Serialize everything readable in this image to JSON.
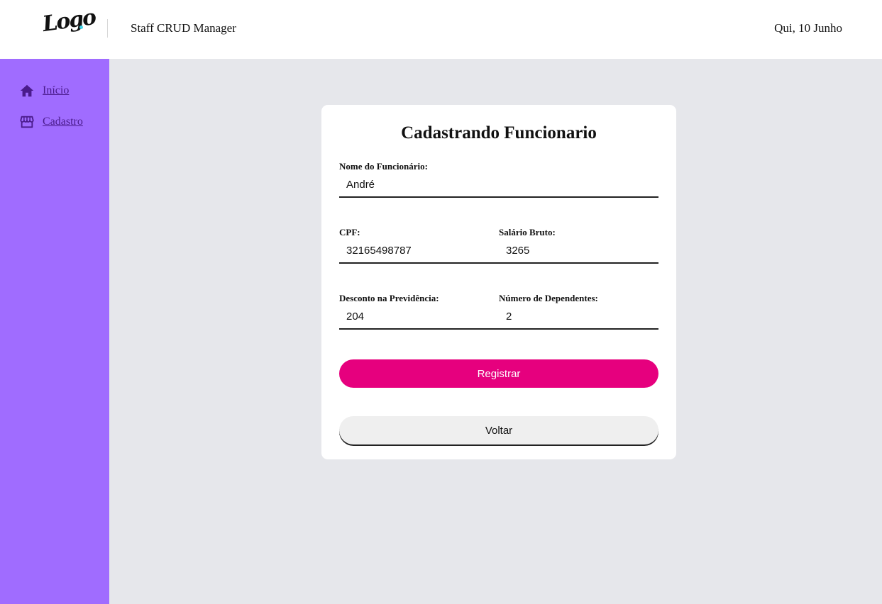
{
  "header": {
    "logo_text": "Logo",
    "app_title": "Staff CRUD Manager",
    "date": "Qui, 10 Junho"
  },
  "sidebar": {
    "items": [
      {
        "label": "Início",
        "icon": "home-icon"
      },
      {
        "label": "Cadastro",
        "icon": "store-icon"
      }
    ]
  },
  "form": {
    "title": "Cadastrando Funcionario",
    "fields": {
      "nome": {
        "label": "Nome do Funcionário:",
        "value": "André"
      },
      "cpf": {
        "label": "CPF:",
        "value": "32165498787"
      },
      "salario": {
        "label": "Salário Bruto:",
        "value": "3265"
      },
      "desconto": {
        "label": "Desconto na Previdência:",
        "value": "204"
      },
      "dependentes": {
        "label": "Número de Dependentes:",
        "value": "2"
      }
    },
    "submit_label": "Registrar",
    "back_label": "Voltar"
  },
  "colors": {
    "sidebar": "#a06cff",
    "nav_text": "#4a1b8c",
    "primary_button": "#e6007e",
    "background": "#e6e7eb"
  }
}
